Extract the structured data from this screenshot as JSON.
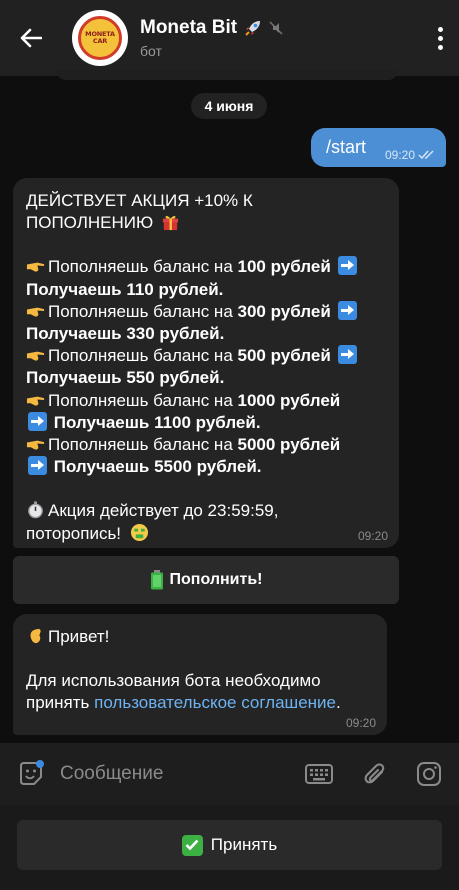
{
  "header": {
    "title": "Moneta Bit",
    "subtitle": "бот",
    "avatar_text_line1": "MONETA",
    "avatar_text_line2": "CAR",
    "title_emoji": "rocket-icon",
    "mute_icon": "muted-bell-icon"
  },
  "date_chip": "4 июня",
  "outgoing": {
    "text": "/start",
    "time": "09:20",
    "status": "read-double-check"
  },
  "message_promo": {
    "headline_1": "ДЕЙСТВУЕТ АКЦИЯ +10% К",
    "headline_2": "ПОПОЛНЕНИЮ",
    "offers": [
      {
        "lead": "Пополняешь баланс на",
        "amount": "100 рублей",
        "result": "Получаешь 110 рублей."
      },
      {
        "lead": "Пополняешь баланс на",
        "amount": "300 рублей",
        "result": "Получаешь 330 рублей."
      },
      {
        "lead": "Пополняешь баланс на",
        "amount": "500 рублей",
        "result": "Получаешь 550 рублей."
      },
      {
        "lead": "Пополняешь баланс на",
        "amount": "1000 рублей",
        "result": "Получаешь 1100 рублей."
      },
      {
        "lead": "Пополняешь баланс на",
        "amount": "5000 рублей",
        "result": "Получаешь 5500 рублей."
      }
    ],
    "footer_1": "Акция действует до 23:59:59,",
    "footer_2": "поторопись!",
    "time": "09:20"
  },
  "inline_button": {
    "label": "Пополнить!"
  },
  "message_welcome": {
    "greeting": "Привет!",
    "body_1": "Для использования бота необходимо",
    "body_2_prefix": "принять",
    "link": "пользовательское соглашение",
    "body_2_suffix": ".",
    "time": "09:20"
  },
  "composer": {
    "placeholder": "Сообщение"
  },
  "reply_keyboard": {
    "accept_label": "Принять"
  },
  "colors": {
    "background": "#0e0e0e",
    "header": "#212121",
    "outgoing_bubble": "#4d8fd4",
    "incoming_bubble": "#242424",
    "link": "#6db3f2"
  }
}
